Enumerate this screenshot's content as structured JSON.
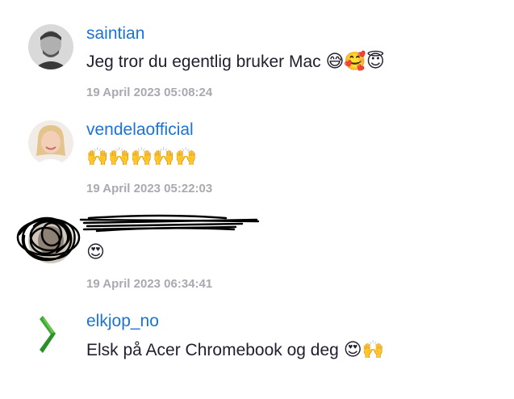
{
  "comments": [
    {
      "username": "saintian",
      "text": "Jeg tror du egentlig bruker Mac",
      "emoji": "😅🥰😇",
      "timestamp": "19 April 2023 05:08:24",
      "avatar_icon": "man-portrait-avatar"
    },
    {
      "username": "vendelaofficial",
      "text": "",
      "emoji": "🙌🙌🙌🙌🙌",
      "timestamp": "19 April 2023 05:22:03",
      "avatar_icon": "woman-portrait-avatar"
    },
    {
      "username": "",
      "username_redacted": true,
      "text": "",
      "emoji": "😍",
      "timestamp": "19 April 2023 06:34:41",
      "avatar_icon": "scribbled-avatar"
    },
    {
      "username": "elkjop_no",
      "text": "Elsk på Acer Chromebook og deg",
      "emoji": "😍🙌",
      "timestamp": "",
      "avatar_icon": "elkjop-logo",
      "brand_color": "#4caf2a"
    }
  ],
  "colors": {
    "username": "#1a73d8",
    "text": "#1f1f2e",
    "timestamp": "#a9a9b0"
  }
}
